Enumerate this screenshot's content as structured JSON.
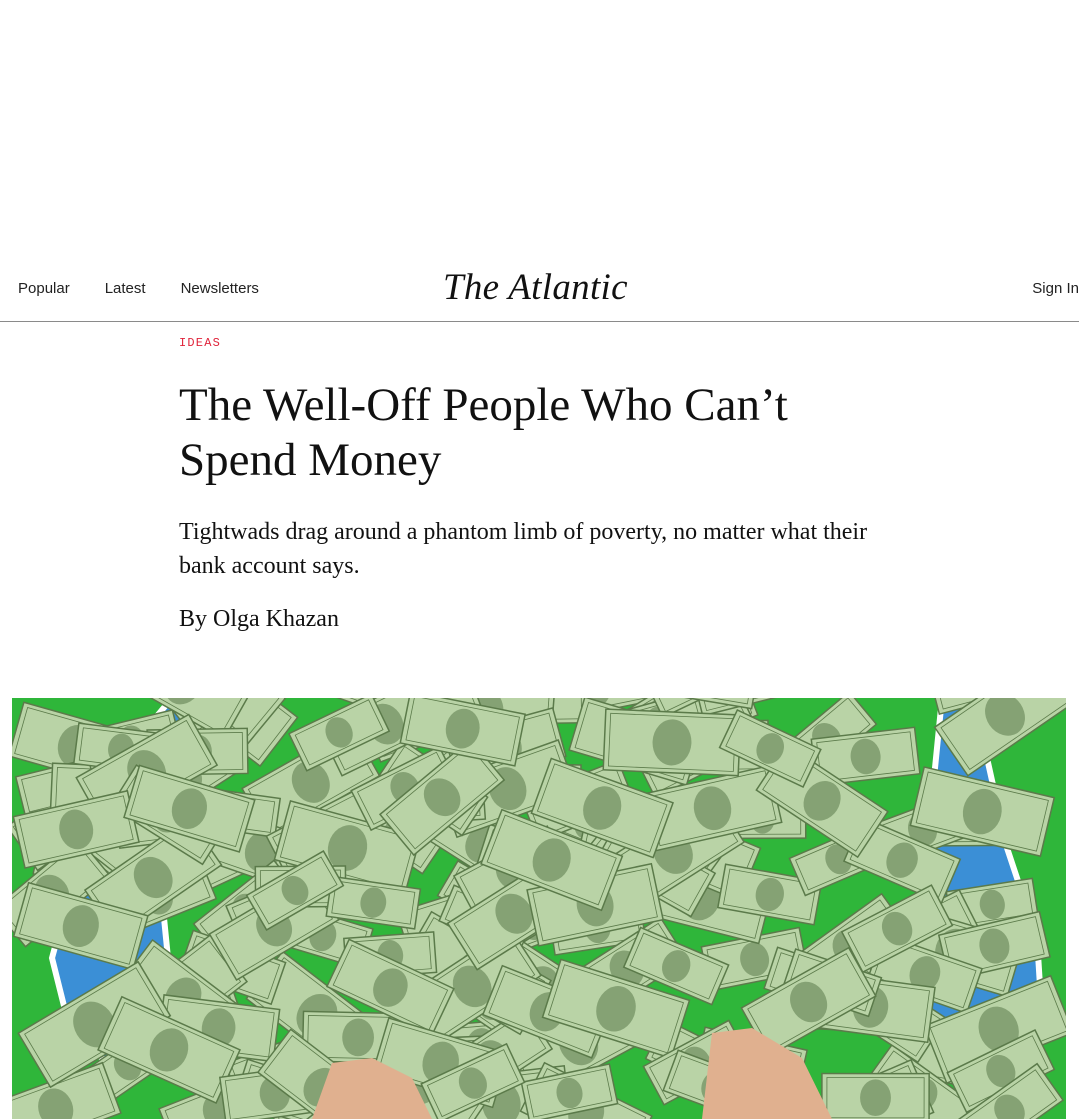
{
  "header": {
    "nav": [
      {
        "label": "Popular"
      },
      {
        "label": "Latest"
      },
      {
        "label": "Newsletters"
      }
    ],
    "logo": "The Atlantic",
    "sign_in": "Sign In"
  },
  "article": {
    "section": "IDEAS",
    "headline": "The Well-Off People Who Can’t Spend Money",
    "dek": "Tightwads drag around a phantom limb of poverty, no matter what their bank account says.",
    "byline_prefix": "By ",
    "author": "Olga Khazan"
  },
  "lead_image": {
    "description_icon": "money-pile-illustration",
    "colors": {
      "background": "#2fb63a",
      "sleeve": "#3b8fd6",
      "bills": "#b9d3a6",
      "bill_dark": "#5b7a4a"
    }
  }
}
